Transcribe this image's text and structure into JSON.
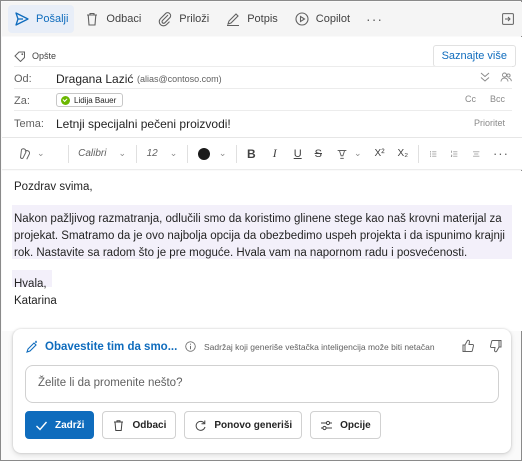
{
  "toolbar": {
    "send_label": "Pošalji",
    "discard_label": "Odbaci",
    "attach_label": "Priloži",
    "signature_label": "Potpis",
    "copilot_label": "Copilot",
    "more_label": "···"
  },
  "header": {
    "sensitivity_label": "Opšte",
    "learn_more_label": "Saznajte više",
    "from_label": "Od:",
    "from_name": "Dragana Lazić",
    "from_alias": "(alias@contoso.com)",
    "to_label": "Za:",
    "recipient_name": "Lidija Bauer",
    "cc_label": "Cc",
    "bcc_label": "Bcc",
    "subject_label": "Tema:",
    "subject_value": "Letnji specijalni pečeni proizvodi!",
    "priority_label": "Prioritet"
  },
  "format_bar": {
    "font_name": "Calibri",
    "font_size": "12",
    "bold_glyph": "B",
    "italic_glyph": "I",
    "underline_glyph": "U",
    "strike_glyph": "S",
    "superscript_glyph": "X²",
    "subscript_glyph": "X₂"
  },
  "message": {
    "greeting": "Pozdrav svima,",
    "body_line_1": "Nakon pažljivog razmatranja, odlučili smo da koristimo glinene stege kao naš krovni materijal za",
    "body_line_2": "projekat. Smatramo da je ovo najbolja opcija da obezbedimo uspeh projekta i da ispunimo krajnji",
    "body_line_3": "rok. Nastavite sa radom što je pre moguće. Hvala vam na napornom radu i posvećenosti.",
    "closing": "Hvala,",
    "signature": "Katarina"
  },
  "copilot": {
    "title": "Obavestite tim da smo...",
    "disclaimer": "Sadržaj koji generiše veštačka inteligencija može biti netačan",
    "input_placeholder": "Želite li da promenite nešto?",
    "keep_label": "Zadrži",
    "discard_label": "Odbaci",
    "regenerate_label": "Ponovo generiši",
    "options_label": "Opcije"
  },
  "colors": {
    "accent": "#0f6cbd",
    "highlight": "#f3f0fa",
    "presence_green": "#6bb700"
  }
}
